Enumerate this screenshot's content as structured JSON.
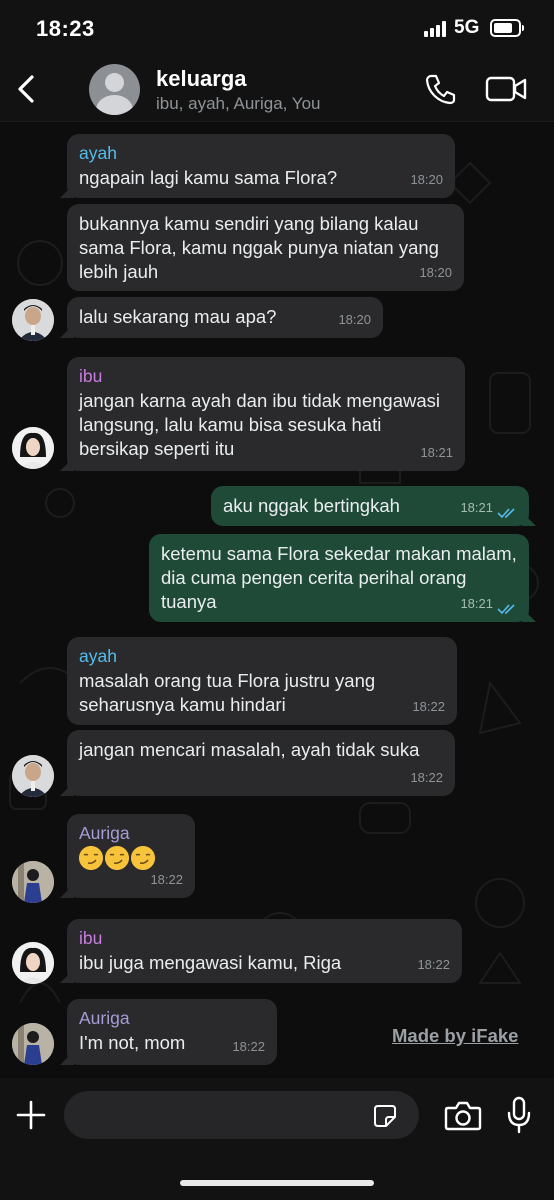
{
  "status_bar": {
    "time": "18:23",
    "network": "5G"
  },
  "header": {
    "title": "keluarga",
    "members": "ibu, ayah, Auriga, You"
  },
  "colors": {
    "ayah": "#53bdeb",
    "ibu": "#c77dde",
    "auriga": "#a79cd6",
    "outgoing_bubble": "#1f4a37",
    "incoming_bubble": "#2a2a2c",
    "read_ticks": "#53bdeb"
  },
  "messages": [
    {
      "sender": "ayah",
      "text": "ngapain lagi kamu sama Flora?",
      "time": "18:20"
    },
    {
      "text": "bukannya kamu sendiri yang bilang kalau sama Flora, kamu nggak punya niatan yang lebih jauh",
      "time": "18:20"
    },
    {
      "text": "lalu sekarang mau apa?",
      "time": "18:20"
    },
    {
      "sender": "ibu",
      "text": "jangan karna ayah dan ibu tidak mengawasi langsung, lalu kamu bisa sesuka hati bersikap seperti itu",
      "time": "18:21"
    },
    {
      "text": "aku nggak bertingkah",
      "time": "18:21"
    },
    {
      "text": "ketemu sama Flora sekedar makan malam, dia cuma pengen cerita perihal orang tuanya",
      "time": "18:21"
    },
    {
      "sender": "ayah",
      "text": "masalah orang tua Flora justru yang seharusnya kamu hindari",
      "time": "18:22"
    },
    {
      "text": "jangan mencari masalah, ayah tidak suka",
      "time": "18:22"
    },
    {
      "sender": "Auriga",
      "emoji": "smirking-face x3",
      "time": "18:22"
    },
    {
      "sender": "ibu",
      "text": "ibu juga mengawasi kamu, Riga",
      "time": "18:22"
    },
    {
      "sender": "Auriga",
      "text": "I'm not, mom",
      "time": "18:22"
    }
  ],
  "watermark": "Made by iFake",
  "input": {
    "placeholder": ""
  },
  "icons": [
    "back-icon",
    "call-icon",
    "video-icon",
    "plus-icon",
    "sticker-icon",
    "camera-icon",
    "mic-icon",
    "double-check-icon",
    "smirking-face-icon"
  ]
}
